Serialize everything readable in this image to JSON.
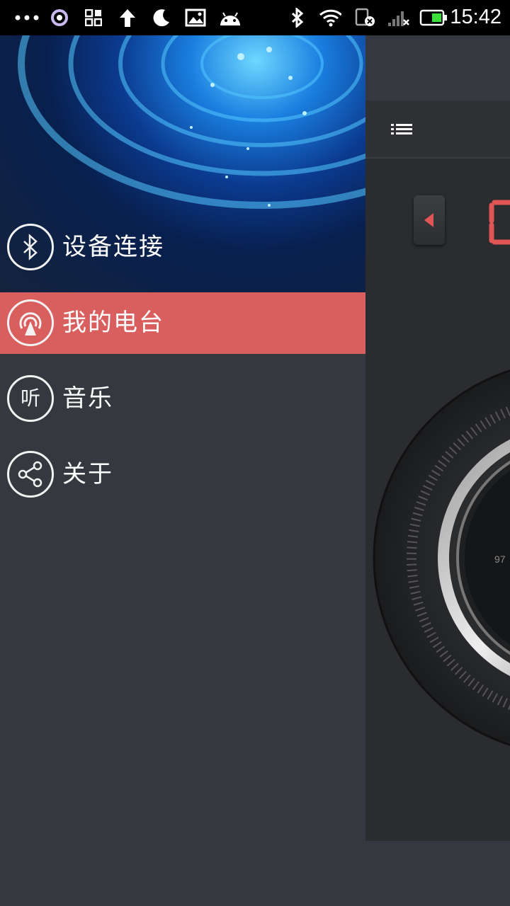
{
  "status_bar": {
    "time": "15:42",
    "icons": [
      "more-dots-icon",
      "ring-icon",
      "apps-grid-icon",
      "upload-arrow-icon",
      "moon-icon",
      "image-icon",
      "android-icon",
      "bluetooth-icon",
      "wifi-icon",
      "sim-off-icon",
      "signal-icon",
      "battery-icon"
    ]
  },
  "drawer": {
    "menu": [
      {
        "label": "设备连接",
        "icon": "bluetooth-icon",
        "active": false
      },
      {
        "label": "我的电台",
        "icon": "radio-tower-icon",
        "active": true
      },
      {
        "label": "音乐",
        "icon": "listen-icon",
        "icon_text": "听",
        "active": false
      },
      {
        "label": "关于",
        "icon": "share-icon",
        "active": false
      }
    ]
  },
  "main": {
    "menu_icon": "list-menu-icon",
    "prev_icon": "triangle-left-icon",
    "dial_label": "97",
    "accent": "#e05656"
  },
  "colors": {
    "drawer_bg": "#35383e",
    "active_item": "#d95f5f",
    "panel_bg": "#2a2c2f"
  }
}
